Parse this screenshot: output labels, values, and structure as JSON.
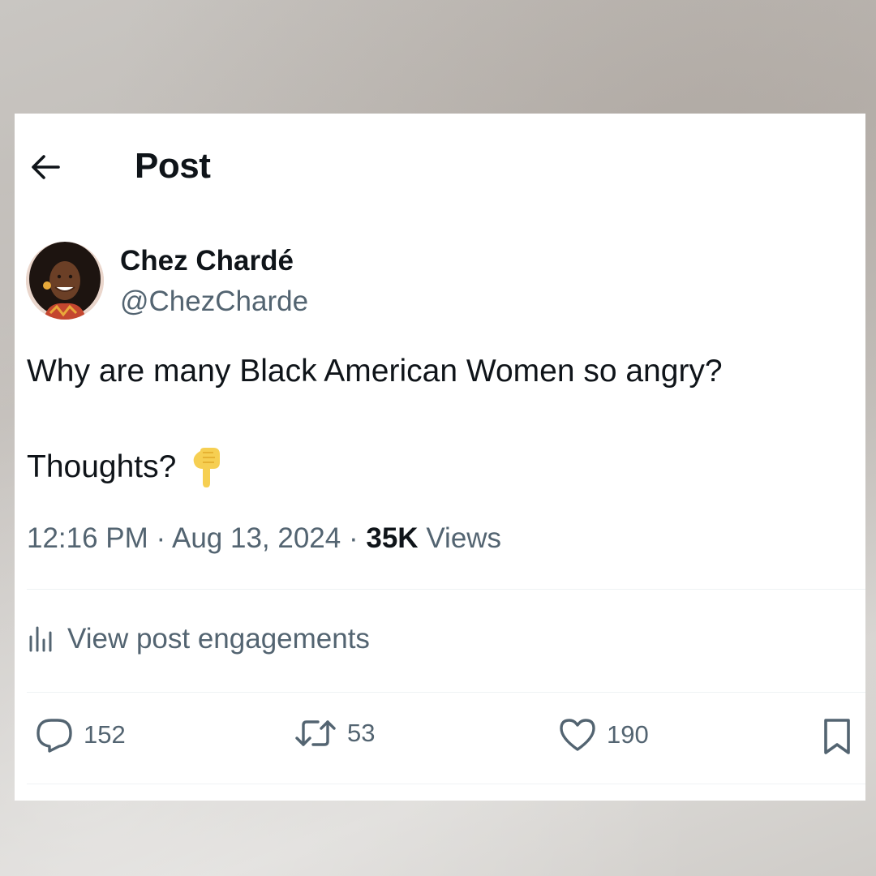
{
  "header": {
    "title": "Post",
    "back_icon": "arrow-left-icon"
  },
  "author": {
    "name": "Chez Chardé",
    "handle": "@ChezCharde"
  },
  "post": {
    "line1": "Why are many Black American Women so angry?",
    "line2": "Thoughts?",
    "emoji": "backhand-index-pointing-down-emoji",
    "time": "12:16 PM",
    "separator": "·",
    "date": "Aug 13, 2024",
    "views_count": "35K",
    "views_label": "Views"
  },
  "engagements": {
    "label": "View post engagements",
    "icon": "analytics-bars-icon"
  },
  "actions": {
    "reply_count": "152",
    "repost_count": "53",
    "like_count": "190",
    "bookmark_icon": "bookmark-icon"
  },
  "colors": {
    "text_primary": "#0f1419",
    "text_secondary": "#536471",
    "divider": "#eff3f4",
    "emoji_yellow": "#f6cf52"
  }
}
